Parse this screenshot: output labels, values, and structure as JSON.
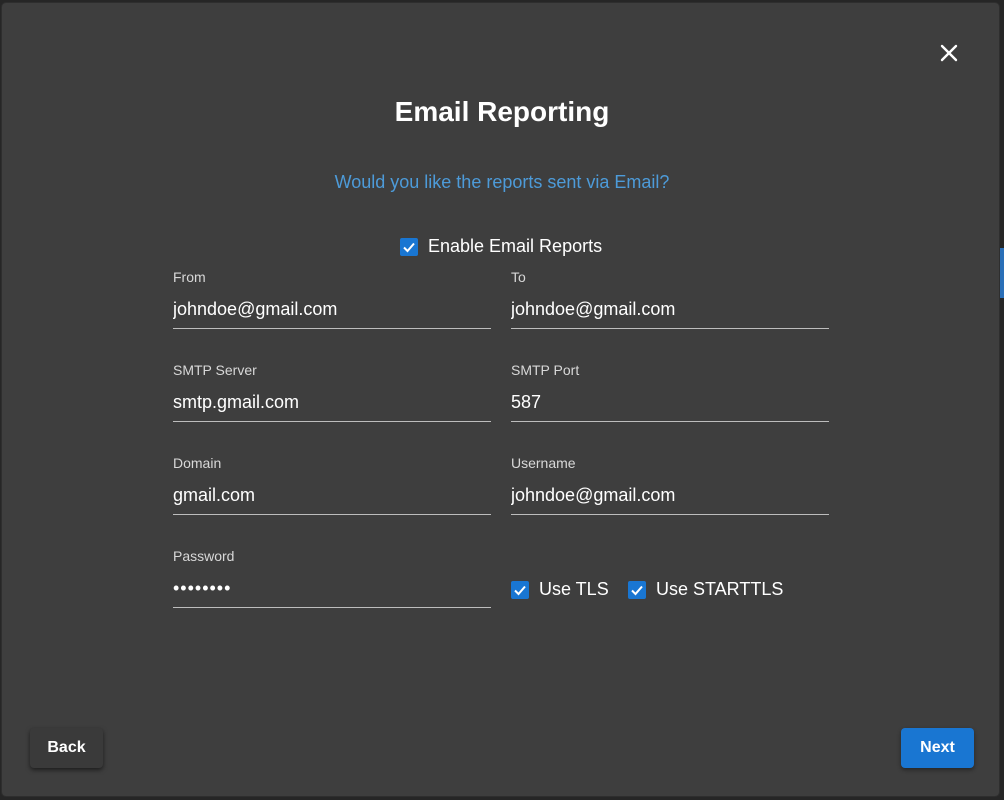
{
  "dialog": {
    "title": "Email Reporting",
    "subtitle": "Would you like the reports sent via Email?",
    "close_icon": "close-icon"
  },
  "enable_reports": {
    "label": "Enable Email Reports",
    "checked": true
  },
  "fields": {
    "from": {
      "label": "From",
      "value": "johndoe@gmail.com"
    },
    "to": {
      "label": "To",
      "value": "johndoe@gmail.com"
    },
    "smtp_server": {
      "label": "SMTP Server",
      "value": "smtp.gmail.com"
    },
    "smtp_port": {
      "label": "SMTP Port",
      "value": "587"
    },
    "domain": {
      "label": "Domain",
      "value": "gmail.com"
    },
    "username": {
      "label": "Username",
      "value": "johndoe@gmail.com"
    },
    "password": {
      "label": "Password",
      "masked_value": "••••••••"
    }
  },
  "options": {
    "use_tls": {
      "label": "Use TLS",
      "checked": true
    },
    "use_starttls": {
      "label": "Use STARTTLS",
      "checked": true
    }
  },
  "buttons": {
    "back": "Back",
    "next": "Next"
  },
  "colors": {
    "accent": "#1976d2",
    "subtitle": "#4d9bd9",
    "modal_bg": "#3e3e3e"
  }
}
